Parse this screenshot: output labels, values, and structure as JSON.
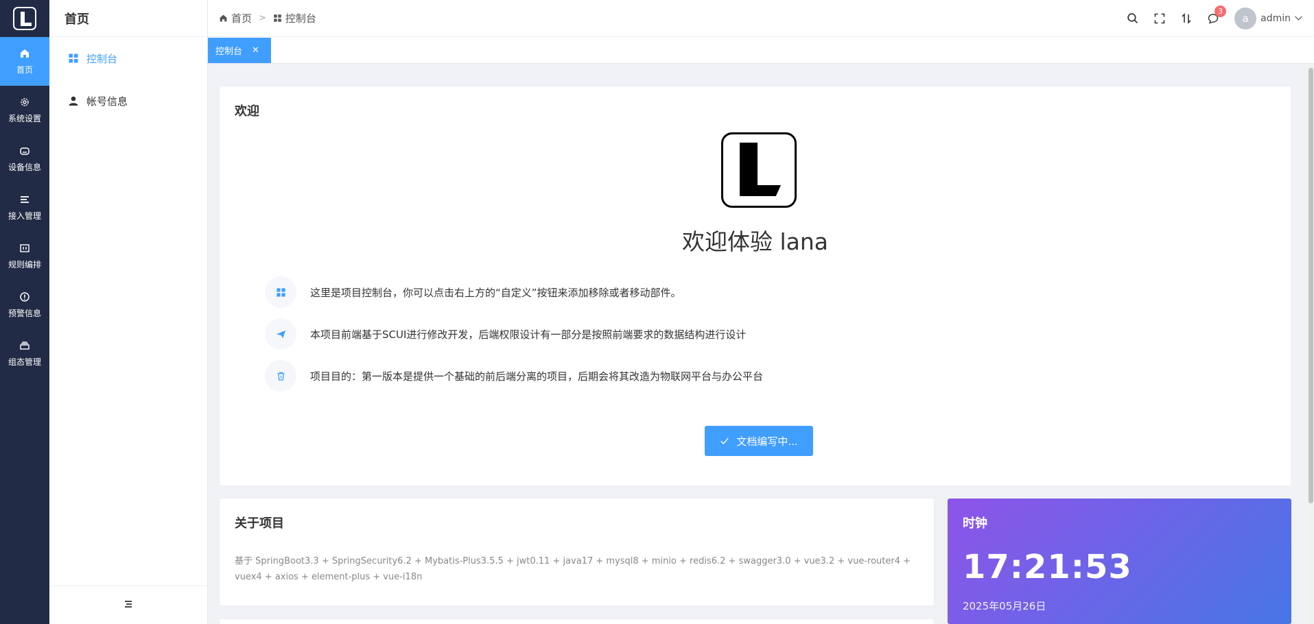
{
  "rail": {
    "items": [
      {
        "label": "首页",
        "icon": "home-icon",
        "active": true
      },
      {
        "label": "系统设置",
        "icon": "gear-icon"
      },
      {
        "label": "设备信息",
        "icon": "device-icon"
      },
      {
        "label": "接入管理",
        "icon": "list-icon"
      },
      {
        "label": "规则编排",
        "icon": "rule-icon"
      },
      {
        "label": "预警信息",
        "icon": "alert-icon"
      },
      {
        "label": "组态管理",
        "icon": "stack-icon"
      }
    ]
  },
  "sidebar": {
    "title": "首页",
    "items": [
      {
        "label": "控制台",
        "icon": "grid-icon",
        "active": true
      },
      {
        "label": "帐号信息",
        "icon": "user-icon"
      }
    ]
  },
  "header": {
    "breadcrumb": [
      "首页",
      "控制台"
    ],
    "notification_count": "3",
    "user": {
      "avatar_letter": "a",
      "name": "admin"
    }
  },
  "tabs": [
    {
      "label": "控制台",
      "active": true
    }
  ],
  "welcome": {
    "title": "欢迎",
    "heading": "欢迎体验 lana",
    "tips": [
      "这里是项目控制台，你可以点击右上方的“自定义”按钮来添加移除或者移动部件。",
      "本项目前端基于SCUI进行修改开发，后端权限设计有一部分是按照前端要求的数据结构进行设计",
      "项目目的：第一版本是提供一个基础的前后端分离的项目，后期会将其改造为物联网平台与办公平台"
    ],
    "doc_button": "文档编写中..."
  },
  "about": {
    "title": "关于项目",
    "text": "基于 SpringBoot3.3 + SpringSecurity6.2 + Mybatis-Plus3.5.5 + jwt0.11 + java17 + mysql8 + minio + redis6.2 + swagger3.0 + vue3.2 + vue-router4 + vuex4 + axios + element-plus + vue-i18n"
  },
  "clock": {
    "title": "时钟",
    "time": "17:21:53",
    "date": "2025年05月26日"
  },
  "colors": {
    "rail_bg": "#222b45",
    "accent": "#409eff",
    "badge": "#f56c6c",
    "clock_gradient_start": "#8e54e9",
    "clock_gradient_end": "#4776e6"
  }
}
